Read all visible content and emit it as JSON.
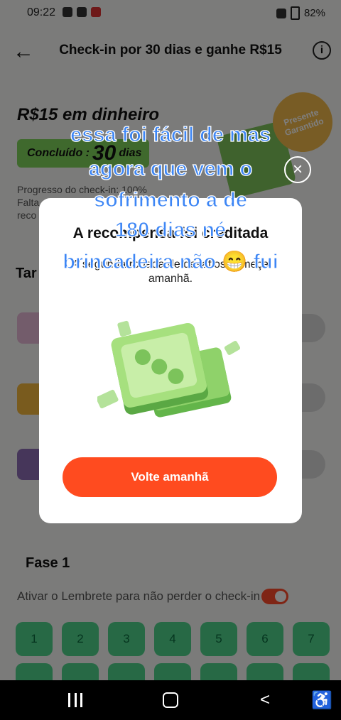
{
  "status_bar": {
    "time": "09:22",
    "battery": "82%"
  },
  "header": {
    "title": "Check-in por 30 dias e ganhe R$15"
  },
  "reward": {
    "title": "R$15 em dinheiro",
    "done_label": "Concluído :",
    "days_num": "30",
    "days_word": "dias"
  },
  "progress": {
    "line1": "Progresso do check-in: 100%",
    "line2": "Falta",
    "line3": "reco"
  },
  "badge": {
    "text": "Presente Garantido"
  },
  "tasks": {
    "heading": "Tar"
  },
  "phase": {
    "title": "Fase 1",
    "reminder": "Ativar o Lembrete para não perder o check-in"
  },
  "days": [
    "1",
    "2",
    "3",
    "4",
    "5",
    "6",
    "7"
  ],
  "modal": {
    "close_glyph": "×",
    "title": "A recompensa foi creditada",
    "subtitle": "A segunda rodada de desafios começa amanhã.",
    "button": "Volte amanhã"
  },
  "caption": {
    "line1": "essa foi fácil de mas",
    "line2": "agora que vem o",
    "line3": "sofrimento a de",
    "line4": "180 dias né",
    "line5": "brincadeira não 😁 fui"
  },
  "icons": {
    "back": "arrow-left-icon",
    "info": "info-icon",
    "close": "close-icon"
  }
}
